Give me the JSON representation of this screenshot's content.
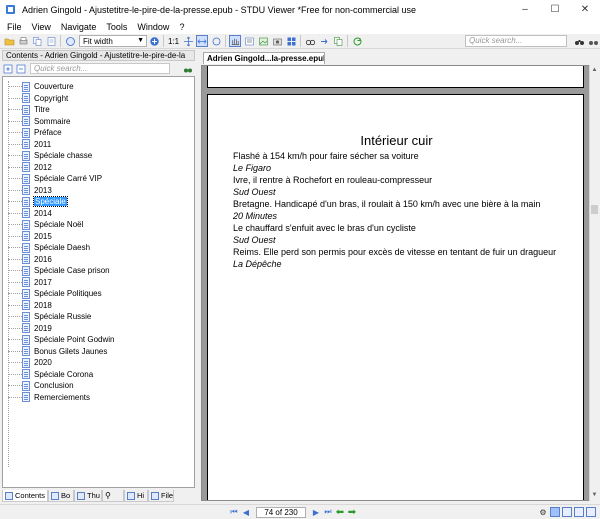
{
  "window": {
    "title": "Adrien Gingold - Ajustetitre-le-pire-de-la-presse.epub - STDU Viewer *Free for non-commercial use",
    "controls": [
      "–",
      "☐",
      "✕"
    ]
  },
  "menu": [
    "File",
    "View",
    "Navigate",
    "Tools",
    "Window",
    "?"
  ],
  "toolbar": {
    "zoom": "Fit width",
    "ratio_label": "1:1",
    "search_placeholder": "Quick search..."
  },
  "left_panel": {
    "header": "Contents - Adrien Gingold - Ajustetitre-le-pire-de-la",
    "search_placeholder": "Quick search...",
    "items": [
      {
        "label": "Couverture"
      },
      {
        "label": "Copyright"
      },
      {
        "label": "Titre"
      },
      {
        "label": "Sommaire"
      },
      {
        "label": "Préface"
      },
      {
        "label": "2011"
      },
      {
        "label": "Spéciale chasse"
      },
      {
        "label": "2012"
      },
      {
        "label": "Spéciale Carré VIP"
      },
      {
        "label": "2013"
      },
      {
        "label": "Spéciale"
      },
      {
        "label": "2014"
      },
      {
        "label": "Spéciale Noël"
      },
      {
        "label": "2015"
      },
      {
        "label": "Spéciale Daesh"
      },
      {
        "label": "2016"
      },
      {
        "label": "Spéciale Case prison"
      },
      {
        "label": "2017"
      },
      {
        "label": "Spéciale Politiques"
      },
      {
        "label": "2018"
      },
      {
        "label": "Spéciale Russie"
      },
      {
        "label": "2019"
      },
      {
        "label": "Spéciale Point Godwin"
      },
      {
        "label": "Bonus Gilets Jaunes"
      },
      {
        "label": "2020"
      },
      {
        "label": "Spéciale Corona"
      },
      {
        "label": "Conclusion"
      },
      {
        "label": "Remerciements"
      }
    ],
    "selected_index": 10,
    "tabs": [
      "Contents",
      "Bo",
      "Thu",
      "",
      "Hi",
      "File"
    ]
  },
  "document": {
    "tab_label": "Adrien Gingold...la-presse.epub",
    "page_title": "Intérieur cuir",
    "lines": [
      {
        "text": "Flashé à 154 km/h pour faire sécher sa voiture",
        "italic": false
      },
      {
        "text": "Le Figaro",
        "italic": true
      },
      {
        "text": "Ivre, il rentre à Rochefort en rouleau-compresseur",
        "italic": false
      },
      {
        "text": "Sud Ouest",
        "italic": true
      },
      {
        "text": "Bretagne. Handicapé d'un bras, il roulait à 150 km/h avec une bière à la main",
        "italic": false
      },
      {
        "text": "20 Minutes",
        "italic": true
      },
      {
        "text": "Le chauffard s'enfuit avec le bras d'un cycliste",
        "italic": false
      },
      {
        "text": "Sud Ouest",
        "italic": true
      },
      {
        "text": "Reims. Elle perd son permis pour excès de vitesse en tentant de fuir un dragueur",
        "italic": false
      },
      {
        "text": "La Dépêche",
        "italic": true
      }
    ]
  },
  "statusbar": {
    "page_indicator": "74 of 230"
  }
}
